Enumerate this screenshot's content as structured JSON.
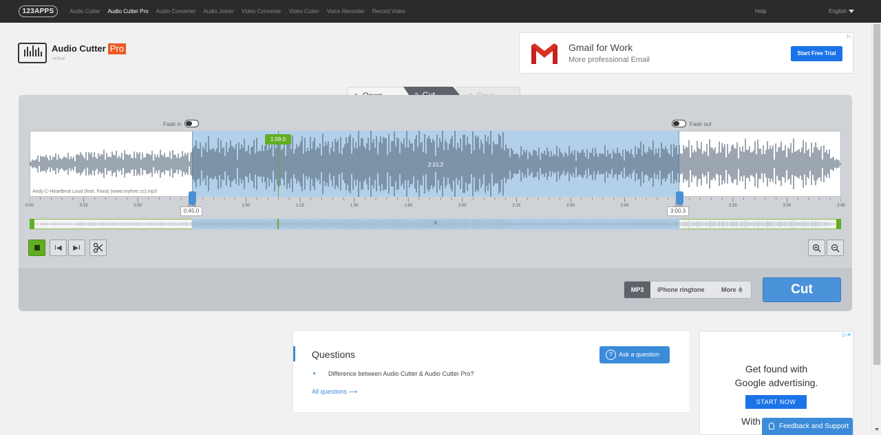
{
  "nav": {
    "logo": "123APPS",
    "links": [
      "Audio Cutter",
      "Audio Cutter Pro",
      "Audio Converter",
      "Audio Joiner",
      "Video Converter",
      "Video Cutter",
      "Voice Recorder",
      "Record Video"
    ],
    "active_index": 1,
    "help": "Help",
    "language": "English"
  },
  "app": {
    "title": "Audio Cutter",
    "badge": "Pro",
    "subtitle": "online"
  },
  "ad_top": {
    "title": "Gmail for Work",
    "subtitle": "More professional Email",
    "button": "Start Free Trial",
    "choices": "▷"
  },
  "steps": [
    {
      "num": "1",
      "label": "Open"
    },
    {
      "num": "2",
      "label": "Cut"
    },
    {
      "num": "3",
      "label": "Save"
    }
  ],
  "editor": {
    "fade_in": "Fade in",
    "fade_out": "Fade out",
    "fade_in_on": false,
    "fade_out_on": false,
    "playhead": "1:09.0",
    "duration": "2:15.2",
    "filename": "Andy C-Heartbeat Loud (feat. Fiora) (www.myfree.cc).mp3",
    "start": "0:45.0",
    "end": "3:00.3",
    "ticks": [
      "0:00",
      "0:15",
      "0:30",
      "0:45",
      "1:00",
      "1:15",
      "1:30",
      "1:45",
      "2:00",
      "2:15",
      "2:30",
      "2:45",
      "3:00",
      "3:15",
      "3:30",
      "3:45"
    ],
    "mini_mid": "II",
    "colors": {
      "selection": "#b2d0ea",
      "playhead": "#62ad21",
      "wave": "#5a6b7b"
    }
  },
  "controls": {
    "play_icon": "stop-icon",
    "prev_label": "I◀",
    "next_label": "▶I",
    "cut_icon": "scissors-icon",
    "zoom_in": "zoom-in-icon",
    "zoom_out": "zoom-out-icon"
  },
  "format": {
    "selected": "MP3",
    "iphone": "iPhone ringtone",
    "more": "More"
  },
  "cut_button": "Cut",
  "questions": {
    "title": "Questions",
    "ask_button": "Ask a question",
    "items": [
      "Difference between Audio Cutter & Audio Cutter Pro?"
    ],
    "all_link": "All questions"
  },
  "ad_side": {
    "line1": "Get found with",
    "line2": "Google advertising.",
    "button": "START NOW",
    "line3": "With"
  },
  "feedback": "Feedback and Support"
}
